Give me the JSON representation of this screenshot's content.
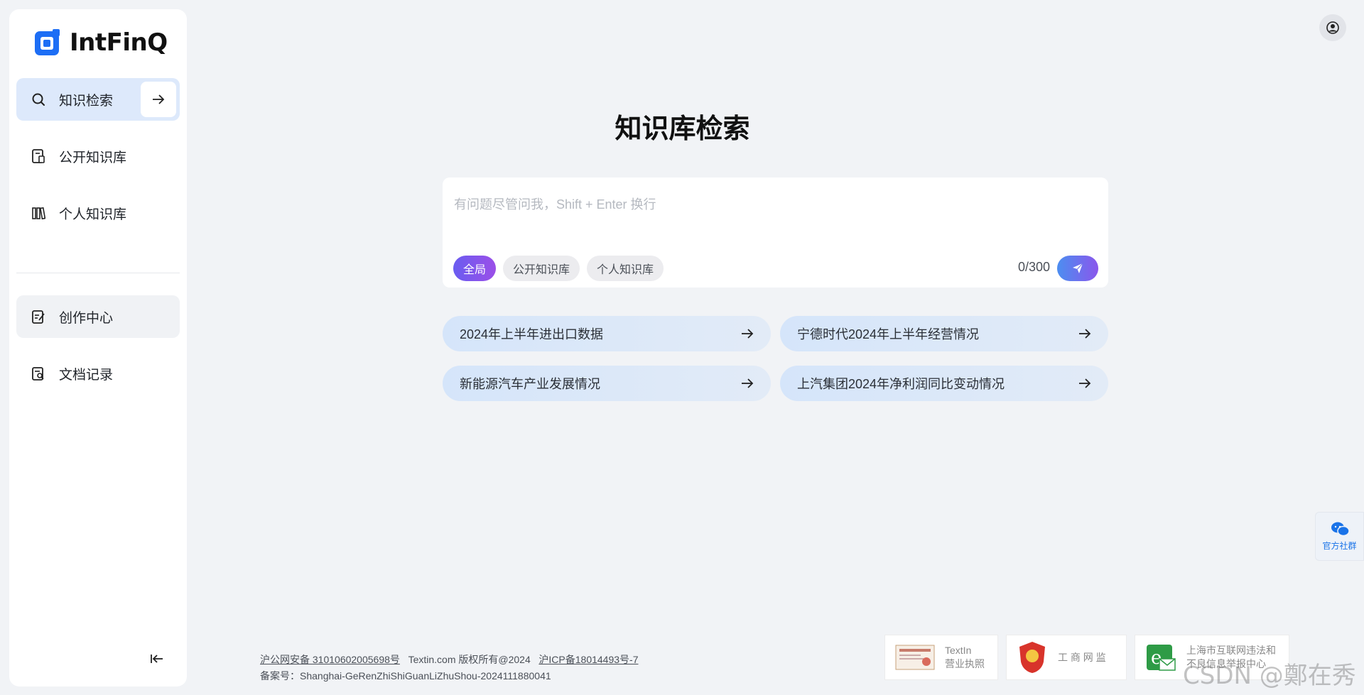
{
  "brand": {
    "name": "IntFinQ",
    "color": "#2563eb"
  },
  "sidebar": {
    "items": [
      {
        "label": "知识检索",
        "icon": "search-icon"
      },
      {
        "label": "公开知识库",
        "icon": "book-icon"
      },
      {
        "label": "个人知识库",
        "icon": "library-icon"
      },
      {
        "label": "创作中心",
        "icon": "edit-doc-icon"
      },
      {
        "label": "文档记录",
        "icon": "doc-search-icon"
      }
    ],
    "go_icon": "arrow-right-icon",
    "collapse_icon": "collapse-left-icon"
  },
  "main": {
    "title": "知识库检索",
    "search": {
      "placeholder": "有问题尽管问我，Shift + Enter 换行",
      "value": "",
      "scopes": [
        "全局",
        "公开知识库",
        "个人知识库"
      ],
      "active_scope": "全局",
      "counter": "0/300"
    },
    "suggestions": [
      "2024年上半年进出口数据",
      "宁德时代2024年上半年经营情况",
      "新能源汽车产业发展情况",
      "上汽集团2024年净利润同比变动情况"
    ]
  },
  "footer": {
    "police_record": "沪公网安备 31010602005698号",
    "copyright": "Textin.com 版权所有@2024",
    "icp": "沪ICP备18014493号-7",
    "filing": "备案号：Shanghai-GeRenZhiShiGuanLiZhuShou-2024111880041",
    "badges": [
      {
        "line1": "TextIn",
        "line2": "营业执照"
      },
      {
        "line1": "工 商 网 监"
      },
      {
        "line1": "上海市互联网违法和",
        "line2": "不良信息举报中心"
      }
    ]
  },
  "community_label": "官方社群",
  "watermark": "CSDN @鄭在秀",
  "colors": {
    "accent_gradient_start": "#6a5cf0",
    "accent_gradient_end": "#9b4fe8",
    "active_nav": "#dde9fb"
  }
}
